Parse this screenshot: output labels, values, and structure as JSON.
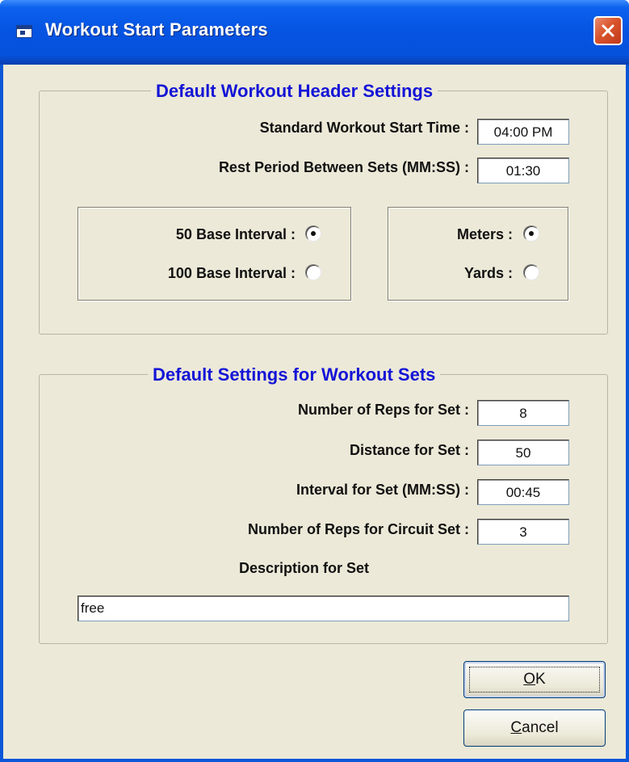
{
  "window": {
    "title": "Workout Start Parameters",
    "title_icon": "app-window-icon",
    "close_icon": "close-icon",
    "close_color": "#d9542c",
    "titlebar_color": "#0553e1"
  },
  "header_group": {
    "legend": "Default Workout Header Settings",
    "legend_color": "#1414d6",
    "start_time_label": "Standard Workout Start Time :",
    "start_time_value": "04:00 PM",
    "rest_label": "Rest Period Between Sets (MM:SS) :",
    "rest_value": "01:30",
    "interval_options": [
      {
        "label": "50 Base Interval :",
        "selected": true
      },
      {
        "label": "100 Base Interval :",
        "selected": false
      }
    ],
    "unit_options": [
      {
        "label": "Meters :",
        "selected": true
      },
      {
        "label": "Yards :",
        "selected": false
      }
    ]
  },
  "sets_group": {
    "legend": "Default Settings for Workout Sets",
    "reps_label": "Number of Reps for Set :",
    "reps_value": "8",
    "distance_label": "Distance for Set :",
    "distance_value": "50",
    "interval_label": "Interval for Set (MM:SS) :",
    "interval_value": "00:45",
    "circuit_label": "Number of Reps for Circuit Set :",
    "circuit_value": "3",
    "description_label": "Description for Set",
    "description_value": "free"
  },
  "buttons": {
    "ok_mnemonic": "O",
    "ok_rest": "K",
    "cancel_mnemonic": "C",
    "cancel_rest": "ancel"
  }
}
